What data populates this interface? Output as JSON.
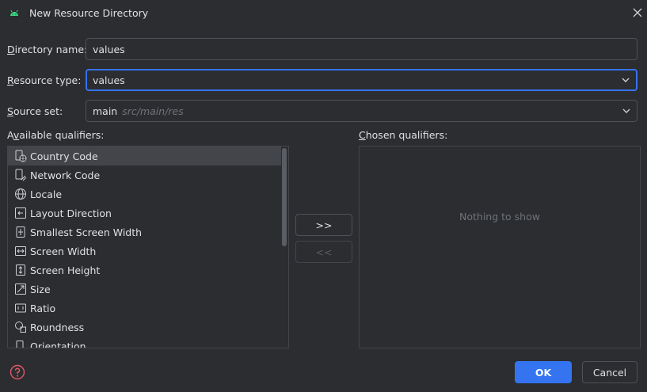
{
  "window": {
    "title": "New Resource Directory"
  },
  "fields": {
    "directory_name": {
      "label_mn": "D",
      "label_rest": "irectory name:",
      "value": "values"
    },
    "resource_type": {
      "label_mn": "R",
      "label_rest": "esource type:",
      "value": "values"
    },
    "source_set": {
      "label_mn": "S",
      "label_rest": "ource set:",
      "value": "main",
      "hint": "src/main/res"
    }
  },
  "available": {
    "label_pre": "A",
    "label_mn": "v",
    "label_rest": "ailable qualifiers:",
    "items": [
      {
        "label": "Country Code",
        "icon": "country-code-icon",
        "selected": true
      },
      {
        "label": "Network Code",
        "icon": "network-code-icon"
      },
      {
        "label": "Locale",
        "icon": "globe-icon"
      },
      {
        "label": "Layout Direction",
        "icon": "layout-direction-icon"
      },
      {
        "label": "Smallest Screen Width",
        "icon": "smallest-width-icon"
      },
      {
        "label": "Screen Width",
        "icon": "screen-width-icon"
      },
      {
        "label": "Screen Height",
        "icon": "screen-height-icon"
      },
      {
        "label": "Size",
        "icon": "size-icon"
      },
      {
        "label": "Ratio",
        "icon": "ratio-icon"
      },
      {
        "label": "Roundness",
        "icon": "roundness-icon"
      },
      {
        "label": "Orientation",
        "icon": "orientation-icon"
      }
    ]
  },
  "chosen": {
    "label_pre": "",
    "label_mn": "C",
    "label_rest": "hosen qualifiers:",
    "empty_text": "Nothing to show"
  },
  "transfer": {
    "add_label": ">>",
    "remove_label": "<<"
  },
  "footer": {
    "ok_label": "OK",
    "cancel_label": "Cancel"
  },
  "colors": {
    "accent": "#3574f0",
    "background": "#2b2d30",
    "android_green": "#3ddc84"
  }
}
